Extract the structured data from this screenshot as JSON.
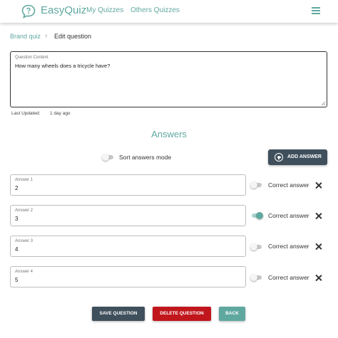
{
  "header": {
    "brand": "EasyQuiz",
    "nav": [
      "My Quizzes",
      "Others Quizzes"
    ],
    "brand_color": "#5fa8a0",
    "logo_icon": "chat-bubble-question-icon",
    "menu_icon": "hamburger-icon"
  },
  "breadcrumb": {
    "items": [
      "Brand quiz",
      "Edit question"
    ],
    "separator": "›"
  },
  "question": {
    "label": "Question Content",
    "value": "How many wheels does a tricycle have?"
  },
  "last_updated": {
    "label": "Last Updated:",
    "value": "1 day ago"
  },
  "answers_section": {
    "title": "Answers",
    "sort_label": "Sort answers mode",
    "sort_enabled": false,
    "add_label": "ADD ANSWER"
  },
  "answers": [
    {
      "label": "Answer 1",
      "value": "2",
      "correct_label": "Correct answer",
      "correct": false
    },
    {
      "label": "Answer 2",
      "value": "3",
      "correct_label": "Correct answer",
      "correct": true
    },
    {
      "label": "Answer 3",
      "value": "4",
      "correct_label": "Correct answer",
      "correct": false
    },
    {
      "label": "Answer 4",
      "value": "5",
      "correct_label": "Correct answer",
      "correct": false
    }
  ],
  "actions": {
    "save": "SAVE QUESTION",
    "delete": "DELETE QUESTION",
    "back": "BACK"
  },
  "colors": {
    "accent": "#5fa8a0",
    "dark_button": "#3f4f5c",
    "danger": "#c0161c"
  }
}
